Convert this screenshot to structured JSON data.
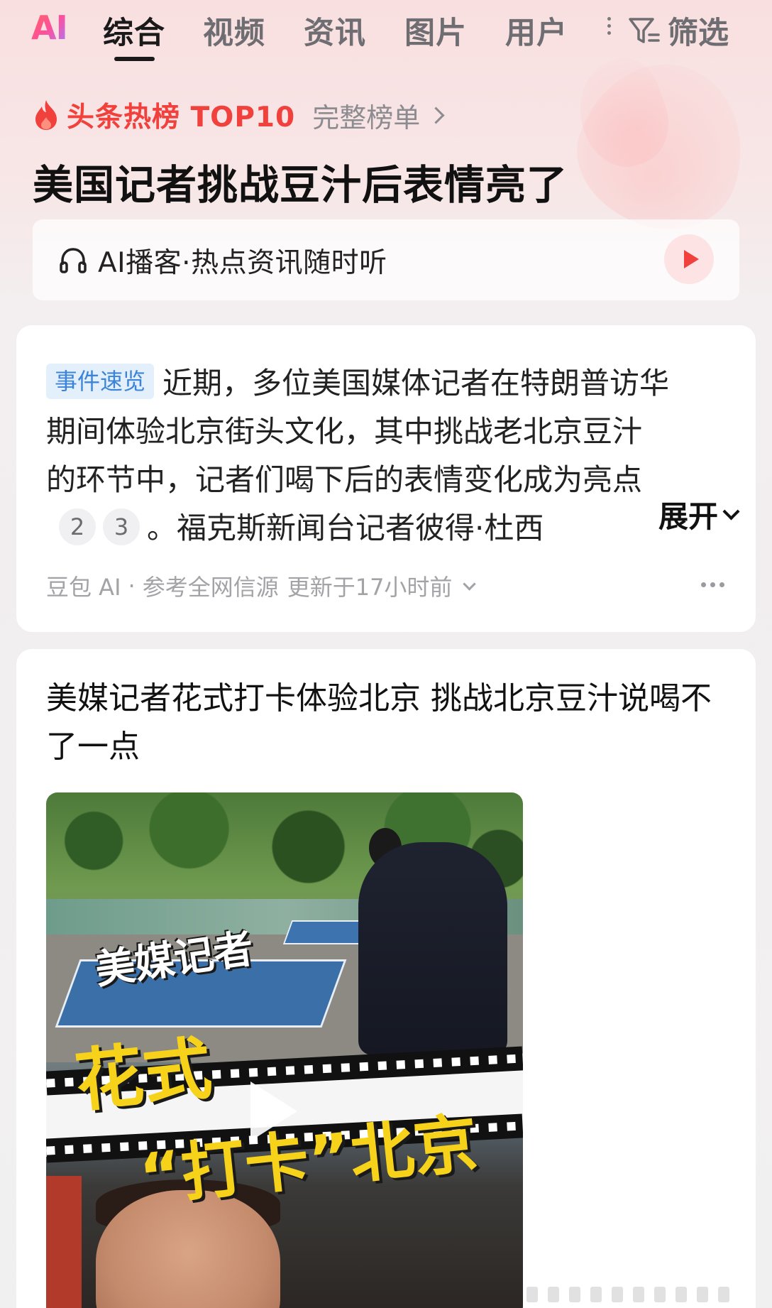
{
  "tabs": {
    "ai": "AI",
    "items": [
      {
        "label": "综合",
        "active": true
      },
      {
        "label": "视频",
        "active": false
      },
      {
        "label": "资讯",
        "active": false
      },
      {
        "label": "图片",
        "active": false
      },
      {
        "label": "用户",
        "active": false
      }
    ],
    "filter_label": "筛选"
  },
  "hot": {
    "label": "头条热榜 TOP10",
    "link": "完整榜单",
    "headline": "美国记者挑战豆汁后表情亮了",
    "accent_color": "#f0413d"
  },
  "podcast": {
    "text": "AI播客·热点资讯随时听"
  },
  "summary": {
    "tag": "事件速览",
    "line1": "近期，多位美国媒体记者在特朗普访华",
    "line2": "期间体验北京街头文化，其中挑战老北京豆汁",
    "line3": "的环节中，记者们喝下后的表情变化成为亮点",
    "ref1": "2",
    "ref2": "3",
    "line4": "。福克斯新闻台记者彼得·杜西",
    "expand": "展开",
    "meta_source": "豆包 AI",
    "meta_ref": "参考全网信源",
    "meta_updated": "更新于17小时前"
  },
  "article": {
    "title": "美媒记者花式打卡体验北京 挑战北京豆汁说喝不了一点",
    "video_caption_1": "美媒记者",
    "video_caption_2": "花式",
    "video_caption_3": "“打卡”北京"
  }
}
